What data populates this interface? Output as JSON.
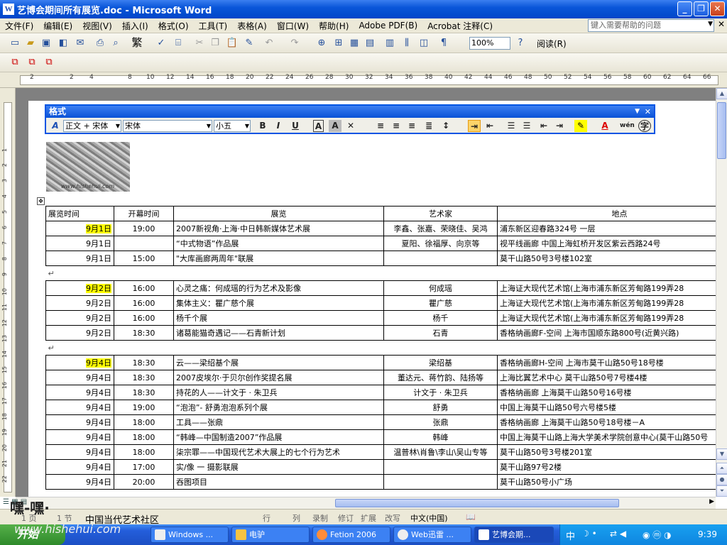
{
  "window": {
    "title": "艺博会期间所有展览.doc - Microsoft Word",
    "app_icon": "W"
  },
  "menubar": {
    "items": [
      "文件(F)",
      "编辑(E)",
      "视图(V)",
      "插入(I)",
      "格式(O)",
      "工具(T)",
      "表格(A)",
      "窗口(W)",
      "帮助(H)",
      "Adobe PDF(B)",
      "Acrobat 注释(C)"
    ],
    "help_placeholder": "键入需要帮助的问题"
  },
  "toolbar": {
    "zoom": "100%",
    "read_label": "阅读(R)",
    "simplified_label": "繁"
  },
  "format_toolbar": {
    "title": "格式",
    "style": "正文 + 宋体",
    "font": "宋体",
    "size": "小五"
  },
  "ruler": {
    "marks": [
      "2",
      "2",
      "4",
      "8",
      "10",
      "12",
      "14",
      "16",
      "18",
      "20",
      "22",
      "24",
      "26",
      "28",
      "30",
      "32",
      "34",
      "36",
      "38",
      "40",
      "42",
      "44",
      "46",
      "48",
      "50",
      "52",
      "54",
      "56",
      "58",
      "60",
      "62",
      "64",
      "66"
    ]
  },
  "vruler": {
    "marks": [
      "1",
      "2",
      "3",
      "4",
      "5",
      "6",
      "7",
      "8",
      "9",
      "10",
      "11",
      "12",
      "13",
      "14",
      "15",
      "16",
      "17",
      "18",
      "19",
      "20",
      "21",
      "22",
      "23",
      "24"
    ]
  },
  "table": {
    "headers": [
      "展览时间",
      "开幕时间",
      "展览",
      "艺术家",
      "地点"
    ],
    "groups": [
      {
        "rows": [
          {
            "date": "9月1日",
            "hl": true,
            "time": "19:00",
            "title": "2007新视角·上海·中日韩新媒体艺术展",
            "artist": "李鑫、张嘉、荣晓佳、吴鸿",
            "place": "浦东新区迎春路324号 一层"
          },
          {
            "date": "9月1日",
            "hl": false,
            "time": "",
            "title": "“中式物语”作品展",
            "artist": "夏阳、徐福厚、向京等",
            "place": "视平线画廊  中国上海虹桥开发区紫云西路24号"
          },
          {
            "date": "9月1日",
            "hl": false,
            "time": "15:00",
            "title": "\"大库画廊两周年\"联展",
            "artist": "",
            "place": "莫干山路50号3号楼102室"
          }
        ]
      },
      {
        "rows": [
          {
            "date": "9月2日",
            "hl": true,
            "time": "16:00",
            "title": "心灵之痛：何成瑶的行为艺术及影像",
            "artist": "何成瑶",
            "place": "上海证大现代艺术馆(上海市浦东新区芳甸路199弄28"
          },
          {
            "date": "9月2日",
            "hl": false,
            "time": "16:00",
            "title": "集体主义：瞿广慈个展",
            "artist": "瞿广慈",
            "place": "上海证大现代艺术馆(上海市浦东新区芳甸路199弄28"
          },
          {
            "date": "9月2日",
            "hl": false,
            "time": "16:00",
            "title": "杨千个展",
            "artist": "杨千",
            "place": "上海证大现代艺术馆(上海市浦东新区芳甸路199弄28"
          },
          {
            "date": "9月2日",
            "hl": false,
            "time": "18:30",
            "title": "诸葛能猫奇遇记——石青新计划",
            "artist": "石青",
            "place": "香格纳画廊F-空间  上海市国顺东路800号(近黄兴路)"
          }
        ]
      },
      {
        "rows": [
          {
            "date": "9月4日",
            "hl": true,
            "time": "18:30",
            "title": "云——梁绍基个展",
            "artist": "梁绍基",
            "place": "香格纳画廊H-空间  上海市莫干山路50号18号楼"
          },
          {
            "date": "9月4日",
            "hl": false,
            "time": "18:30",
            "title": "2007皮埃尔·于贝尔创作奖提名展",
            "artist": "董达元、蒋竹韵、陆扬等",
            "place": "上海比翼艺术中心 莫干山路50号7号楼4楼"
          },
          {
            "date": "9月4日",
            "hl": false,
            "time": "18:30",
            "title": "持花的人——计文于 · 朱卫兵",
            "artist": "计文于 · 朱卫兵",
            "place": "香格纳画廊  上海莫干山路50号16号楼"
          },
          {
            "date": "9月4日",
            "hl": false,
            "time": "19:00",
            "title": "“泡泡”- 舒勇泡泡系列个展",
            "artist": "舒勇",
            "place": "中国上海莫干山路50号六号楼5楼"
          },
          {
            "date": "9月4日",
            "hl": false,
            "time": "18:00",
            "title": "工具——张鼎",
            "artist": "张鼎",
            "place": "香格纳画廊  上海莫干山路50号18号楼－A"
          },
          {
            "date": "9月4日",
            "hl": false,
            "time": "18:00",
            "title": "“韩峰—中国制造2007”作品展",
            "artist": "韩峰",
            "place": "中国上海莫干山路上海大学美术学院创意中心(莫干山路50号"
          },
          {
            "date": "9月4日",
            "hl": false,
            "time": "18:00",
            "title": "柒宗罪——中国现代艺术大展上的七个行为艺术",
            "artist": "温普林\\肖鲁\\李山\\吴山专等",
            "place": "莫干山路50号3号楼201室"
          },
          {
            "date": "9月4日",
            "hl": false,
            "time": "17:00",
            "title": "实/像 一 摄影联展",
            "artist": "",
            "place": "莫干山路97号2楼"
          },
          {
            "date": "9月4日",
            "hl": false,
            "time": "20:00",
            "title": "吞图项目",
            "artist": "",
            "place": "莫干山路50号小广场"
          }
        ]
      }
    ]
  },
  "statusbar": {
    "page": "1 页",
    "section": "1 节",
    "pos": "1/1",
    "items": [
      "行",
      "列",
      "录制",
      "修订",
      "扩展",
      "改写",
      "中文(中国)"
    ]
  },
  "watermark": {
    "top": "嘿-嘿·",
    "bottom": "www.hishehui.com",
    "logo_caption": "www.hishehui.com",
    "status_caption": "中国当代艺术社区"
  },
  "taskbar": {
    "start": "开始",
    "tasks": [
      "Windows ...",
      "电驴",
      "Fetion 2006",
      "Web迅雷 ...",
      "艺博会期..."
    ],
    "clock": "9:39"
  }
}
